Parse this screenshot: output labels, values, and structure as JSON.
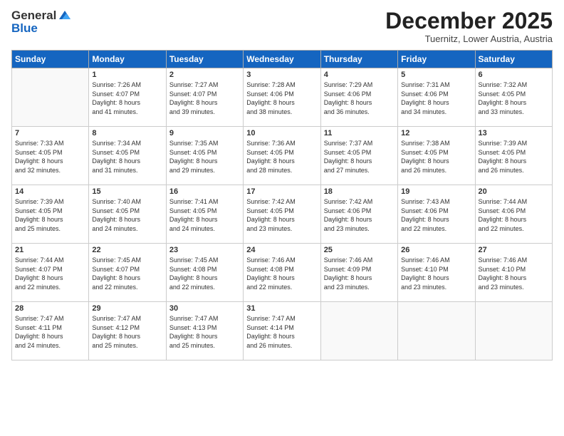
{
  "logo": {
    "general": "General",
    "blue": "Blue"
  },
  "title": "December 2025",
  "subtitle": "Tuernitz, Lower Austria, Austria",
  "weekdays": [
    "Sunday",
    "Monday",
    "Tuesday",
    "Wednesday",
    "Thursday",
    "Friday",
    "Saturday"
  ],
  "weeks": [
    [
      {
        "day": "",
        "info": ""
      },
      {
        "day": "1",
        "info": "Sunrise: 7:26 AM\nSunset: 4:07 PM\nDaylight: 8 hours\nand 41 minutes."
      },
      {
        "day": "2",
        "info": "Sunrise: 7:27 AM\nSunset: 4:07 PM\nDaylight: 8 hours\nand 39 minutes."
      },
      {
        "day": "3",
        "info": "Sunrise: 7:28 AM\nSunset: 4:06 PM\nDaylight: 8 hours\nand 38 minutes."
      },
      {
        "day": "4",
        "info": "Sunrise: 7:29 AM\nSunset: 4:06 PM\nDaylight: 8 hours\nand 36 minutes."
      },
      {
        "day": "5",
        "info": "Sunrise: 7:31 AM\nSunset: 4:06 PM\nDaylight: 8 hours\nand 34 minutes."
      },
      {
        "day": "6",
        "info": "Sunrise: 7:32 AM\nSunset: 4:05 PM\nDaylight: 8 hours\nand 33 minutes."
      }
    ],
    [
      {
        "day": "7",
        "info": "Sunrise: 7:33 AM\nSunset: 4:05 PM\nDaylight: 8 hours\nand 32 minutes."
      },
      {
        "day": "8",
        "info": "Sunrise: 7:34 AM\nSunset: 4:05 PM\nDaylight: 8 hours\nand 31 minutes."
      },
      {
        "day": "9",
        "info": "Sunrise: 7:35 AM\nSunset: 4:05 PM\nDaylight: 8 hours\nand 29 minutes."
      },
      {
        "day": "10",
        "info": "Sunrise: 7:36 AM\nSunset: 4:05 PM\nDaylight: 8 hours\nand 28 minutes."
      },
      {
        "day": "11",
        "info": "Sunrise: 7:37 AM\nSunset: 4:05 PM\nDaylight: 8 hours\nand 27 minutes."
      },
      {
        "day": "12",
        "info": "Sunrise: 7:38 AM\nSunset: 4:05 PM\nDaylight: 8 hours\nand 26 minutes."
      },
      {
        "day": "13",
        "info": "Sunrise: 7:39 AM\nSunset: 4:05 PM\nDaylight: 8 hours\nand 26 minutes."
      }
    ],
    [
      {
        "day": "14",
        "info": "Sunrise: 7:39 AM\nSunset: 4:05 PM\nDaylight: 8 hours\nand 25 minutes."
      },
      {
        "day": "15",
        "info": "Sunrise: 7:40 AM\nSunset: 4:05 PM\nDaylight: 8 hours\nand 24 minutes."
      },
      {
        "day": "16",
        "info": "Sunrise: 7:41 AM\nSunset: 4:05 PM\nDaylight: 8 hours\nand 24 minutes."
      },
      {
        "day": "17",
        "info": "Sunrise: 7:42 AM\nSunset: 4:05 PM\nDaylight: 8 hours\nand 23 minutes."
      },
      {
        "day": "18",
        "info": "Sunrise: 7:42 AM\nSunset: 4:06 PM\nDaylight: 8 hours\nand 23 minutes."
      },
      {
        "day": "19",
        "info": "Sunrise: 7:43 AM\nSunset: 4:06 PM\nDaylight: 8 hours\nand 22 minutes."
      },
      {
        "day": "20",
        "info": "Sunrise: 7:44 AM\nSunset: 4:06 PM\nDaylight: 8 hours\nand 22 minutes."
      }
    ],
    [
      {
        "day": "21",
        "info": "Sunrise: 7:44 AM\nSunset: 4:07 PM\nDaylight: 8 hours\nand 22 minutes."
      },
      {
        "day": "22",
        "info": "Sunrise: 7:45 AM\nSunset: 4:07 PM\nDaylight: 8 hours\nand 22 minutes."
      },
      {
        "day": "23",
        "info": "Sunrise: 7:45 AM\nSunset: 4:08 PM\nDaylight: 8 hours\nand 22 minutes."
      },
      {
        "day": "24",
        "info": "Sunrise: 7:46 AM\nSunset: 4:08 PM\nDaylight: 8 hours\nand 22 minutes."
      },
      {
        "day": "25",
        "info": "Sunrise: 7:46 AM\nSunset: 4:09 PM\nDaylight: 8 hours\nand 23 minutes."
      },
      {
        "day": "26",
        "info": "Sunrise: 7:46 AM\nSunset: 4:10 PM\nDaylight: 8 hours\nand 23 minutes."
      },
      {
        "day": "27",
        "info": "Sunrise: 7:46 AM\nSunset: 4:10 PM\nDaylight: 8 hours\nand 23 minutes."
      }
    ],
    [
      {
        "day": "28",
        "info": "Sunrise: 7:47 AM\nSunset: 4:11 PM\nDaylight: 8 hours\nand 24 minutes."
      },
      {
        "day": "29",
        "info": "Sunrise: 7:47 AM\nSunset: 4:12 PM\nDaylight: 8 hours\nand 25 minutes."
      },
      {
        "day": "30",
        "info": "Sunrise: 7:47 AM\nSunset: 4:13 PM\nDaylight: 8 hours\nand 25 minutes."
      },
      {
        "day": "31",
        "info": "Sunrise: 7:47 AM\nSunset: 4:14 PM\nDaylight: 8 hours\nand 26 minutes."
      },
      {
        "day": "",
        "info": ""
      },
      {
        "day": "",
        "info": ""
      },
      {
        "day": "",
        "info": ""
      }
    ]
  ]
}
